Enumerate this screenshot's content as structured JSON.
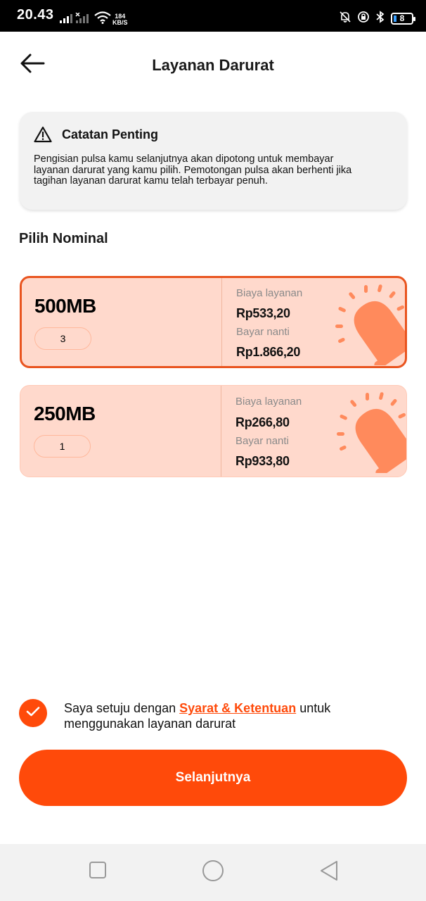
{
  "status_bar": {
    "time": "20.43",
    "net_speed_value": "184",
    "net_speed_unit": "KB/S",
    "battery": "8"
  },
  "header": {
    "title": "Layanan Darurat"
  },
  "notice": {
    "title": "Catatan Penting",
    "body": "Pengisian pulsa kamu selanjutnya akan dipotong untuk membayar layanan darurat yang kamu pilih. Pemotongan pulsa akan berhenti jika tagihan layanan darurat kamu telah terbayar penuh."
  },
  "section_title": "Pilih Nominal",
  "options": [
    {
      "size": "500MB",
      "quantity": "3",
      "fee_label": "Biaya layanan",
      "fee": "Rp533,20",
      "later_label": "Bayar nanti",
      "later": "Rp1.866,20",
      "selected": true
    },
    {
      "size": "250MB",
      "quantity": "1",
      "fee_label": "Biaya layanan",
      "fee": "Rp266,80",
      "later_label": "Bayar nanti",
      "later": "Rp933,80",
      "selected": false
    }
  ],
  "agreement": {
    "checked": true,
    "prefix": "Saya setuju dengan ",
    "link": "Syarat & Ketentuan",
    "suffix": " untuk menggunakan layanan darurat"
  },
  "next_button": "Selanjutnya",
  "icons": {
    "back": "arrow-left-icon",
    "warning": "warning-triangle-icon",
    "siren": "siren-icon",
    "check": "check-icon",
    "nav_recents": "square-icon",
    "nav_home": "circle-icon",
    "nav_back": "triangle-back-icon"
  },
  "colors": {
    "accent": "#ff4a0a",
    "card_bg": "#ffd9cc",
    "card_border_selected": "#e9541f",
    "siren": "#ff8a5c"
  }
}
